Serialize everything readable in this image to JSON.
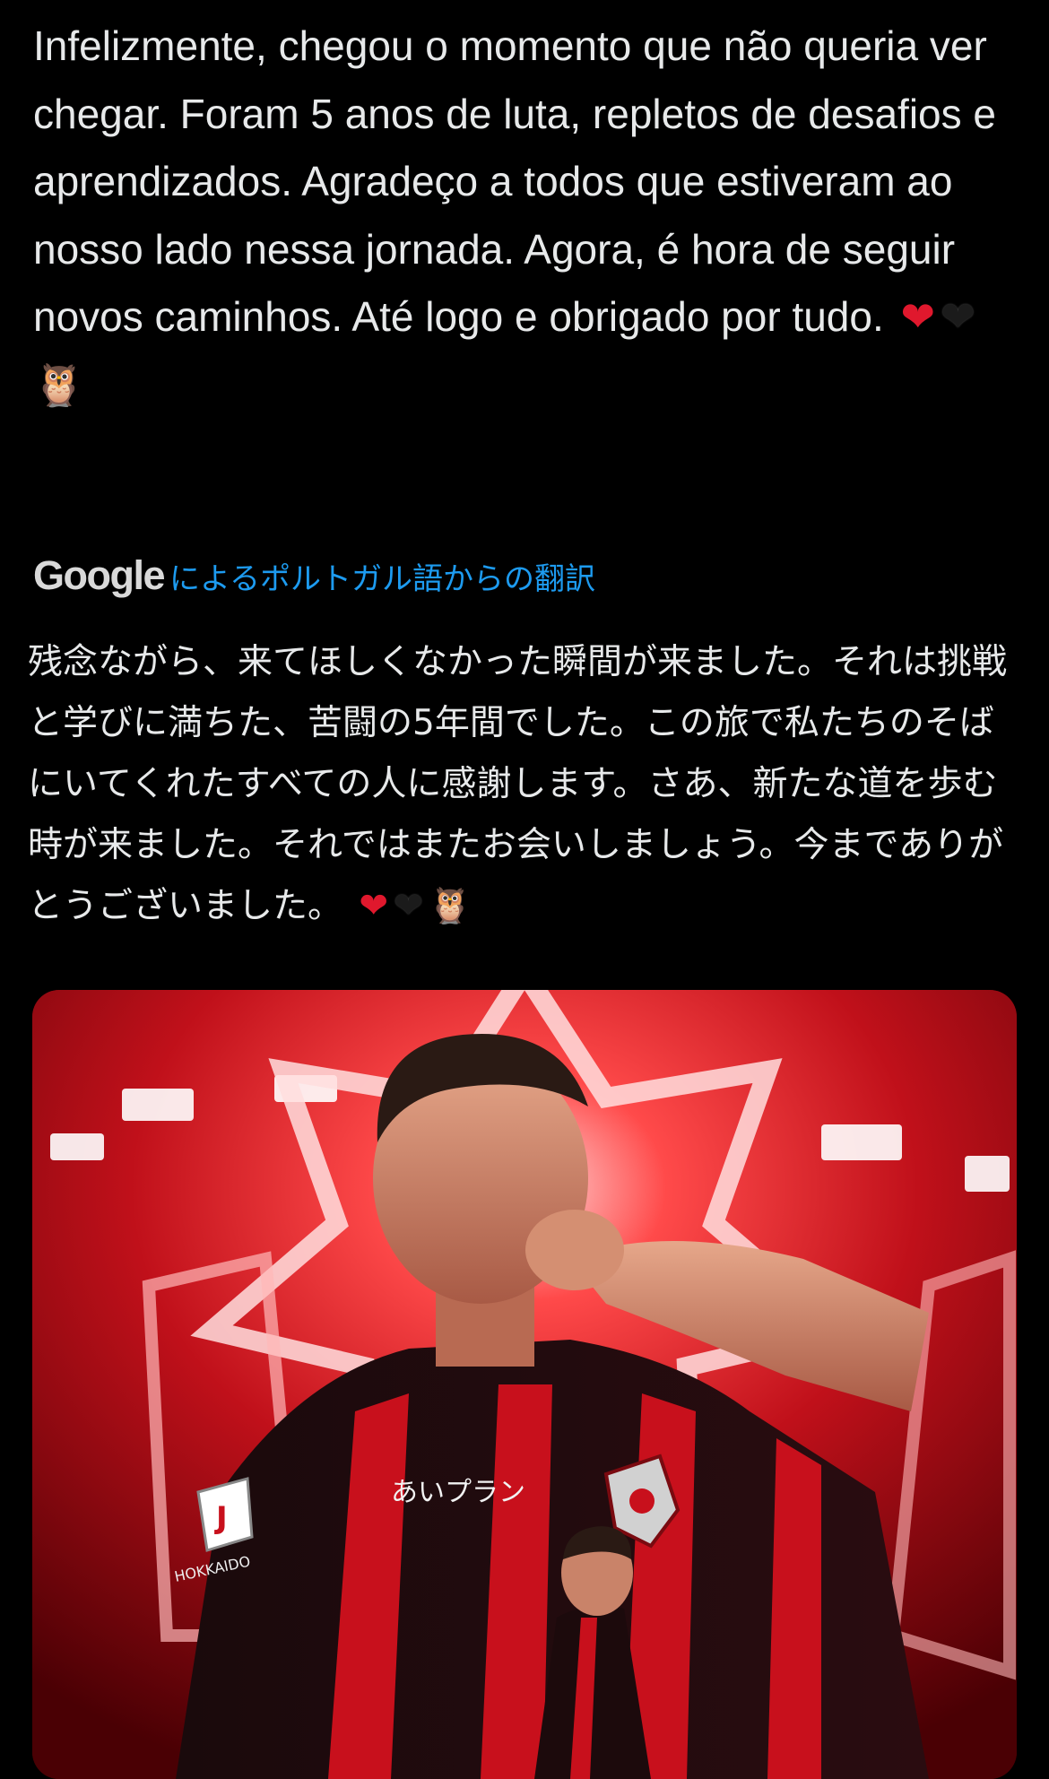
{
  "post": {
    "text": "Infelizmente, chegou o momento que não queria ver chegar. Foram 5 anos de luta, repletos de desafios e aprendizados. Agradeço a todos que estiveram ao nosso lado nessa jornada. Agora, é hora de seguir novos caminhos. Até logo e obrigado por tudo.",
    "emojis": [
      "red-heart",
      "black-heart",
      "owl"
    ]
  },
  "translation": {
    "provider": "Google",
    "label": "によるポルトガル語からの翻訳",
    "text": "残念ながら、来てほしくなかった瞬間が来ました。それは挑戦と学びに満ちた、苦闘の5年間でした。この旅で私たちのそばにいてくれたすべての人に感謝します。さあ、新たな道を歩む時が来ました。それではまたお会いしましょう。今までありがとうございました。"
  },
  "media": {
    "jersey_sponsor": "あいプラン",
    "jersey_badge_text": "HOKKAIDO",
    "colors": {
      "background": "#000000",
      "text": "#e7e9ea",
      "link": "#1d9bf0",
      "accent_red": "#d4141e"
    }
  }
}
